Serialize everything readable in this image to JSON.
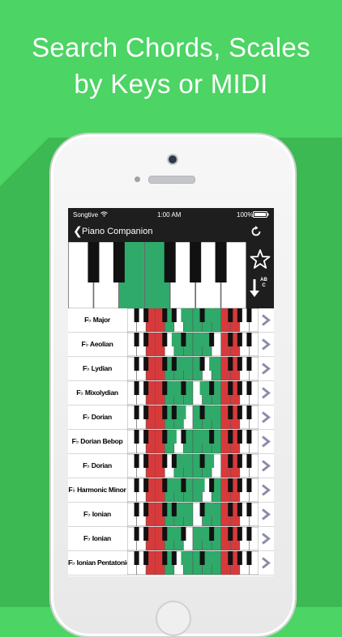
{
  "headline": {
    "line1": "Search Chords, Scales",
    "line2": "by Keys or MIDI"
  },
  "statusbar": {
    "carrier": "Songtive",
    "time": "1:00 AM",
    "battery": "100%"
  },
  "navbar": {
    "back_label": "Piano Companion",
    "refresh_icon": "refresh-icon"
  },
  "side_buttons": {
    "favorite_icon": "star-icon",
    "sort_icon": "sort-abc-icon",
    "sort_letters": "ABC"
  },
  "colors": {
    "background": "#4cd464",
    "highlight_green": "#2faa6a",
    "highlight_red": "#d8393b"
  },
  "keyboard": {
    "highlighted_white_keys": [
      2,
      3
    ]
  },
  "scales": [
    {
      "label": "F♭ Major"
    },
    {
      "label": "F♭ Aeolian"
    },
    {
      "label": "F♭ Lydian"
    },
    {
      "label": "F♭ Mixolydian"
    },
    {
      "label": "F♭ Dorian"
    },
    {
      "label": "F♭ Dorian Bebop"
    },
    {
      "label": "F♭ Dorian"
    },
    {
      "label": "F♭ Harmonic Minor"
    },
    {
      "label": "F♭ Ionian"
    },
    {
      "label": "F♭ Ionian"
    },
    {
      "label": "F♭ Ionian Pentatonic"
    }
  ]
}
